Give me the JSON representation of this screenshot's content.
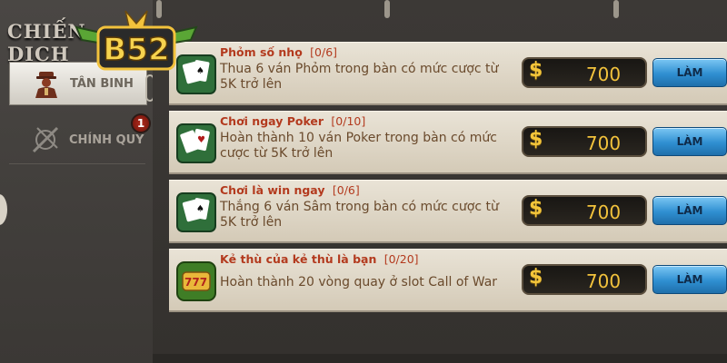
{
  "screen_title": "CHIẾN DỊCH",
  "logo_text": "B52",
  "sidebar": {
    "tabs": [
      {
        "label": "TÂN BINH",
        "icon": "soldier-icon",
        "active": true
      },
      {
        "label": "CHÍNH QUY",
        "icon": "crossed-rifles-icon",
        "active": false,
        "badge": "1"
      }
    ]
  },
  "missions": [
    {
      "icon": "playing-cards-icon",
      "title": "Phỏm số nhọ",
      "progress": "[0/6]",
      "description": "Thua 6 ván Phỏm trong bàn có mức cược từ 5K trở lên",
      "currency_symbol": "$",
      "reward": "700",
      "button_label": "LÀM"
    },
    {
      "icon": "poker-cards-icon",
      "title": "Chơi ngay Poker",
      "progress": "[0/10]",
      "description": "Hoàn thành 10 ván Poker trong bàn có mức cược từ 5K trở lên",
      "currency_symbol": "$",
      "reward": "700",
      "button_label": "LÀM"
    },
    {
      "icon": "playing-cards-icon",
      "title": "Chơi là win ngay",
      "progress": "[0/6]",
      "description": "Thắng 6 ván Sâm trong bàn có mức cược từ 5K trở lên",
      "currency_symbol": "$",
      "reward": "700",
      "button_label": "LÀM"
    },
    {
      "icon": "slot-777-icon",
      "title": "Kẻ thù của kẻ thù là bạn",
      "progress": "[0/20]",
      "description": "Hoàn thành 20 vòng quay ở slot Call of War",
      "currency_symbol": "$",
      "reward": "700",
      "button_label": "LÀM"
    }
  ],
  "colors": {
    "accent_title": "#b33a1e",
    "reward_gold": "#f2c23c",
    "button_blue": "#2f8fd1"
  }
}
